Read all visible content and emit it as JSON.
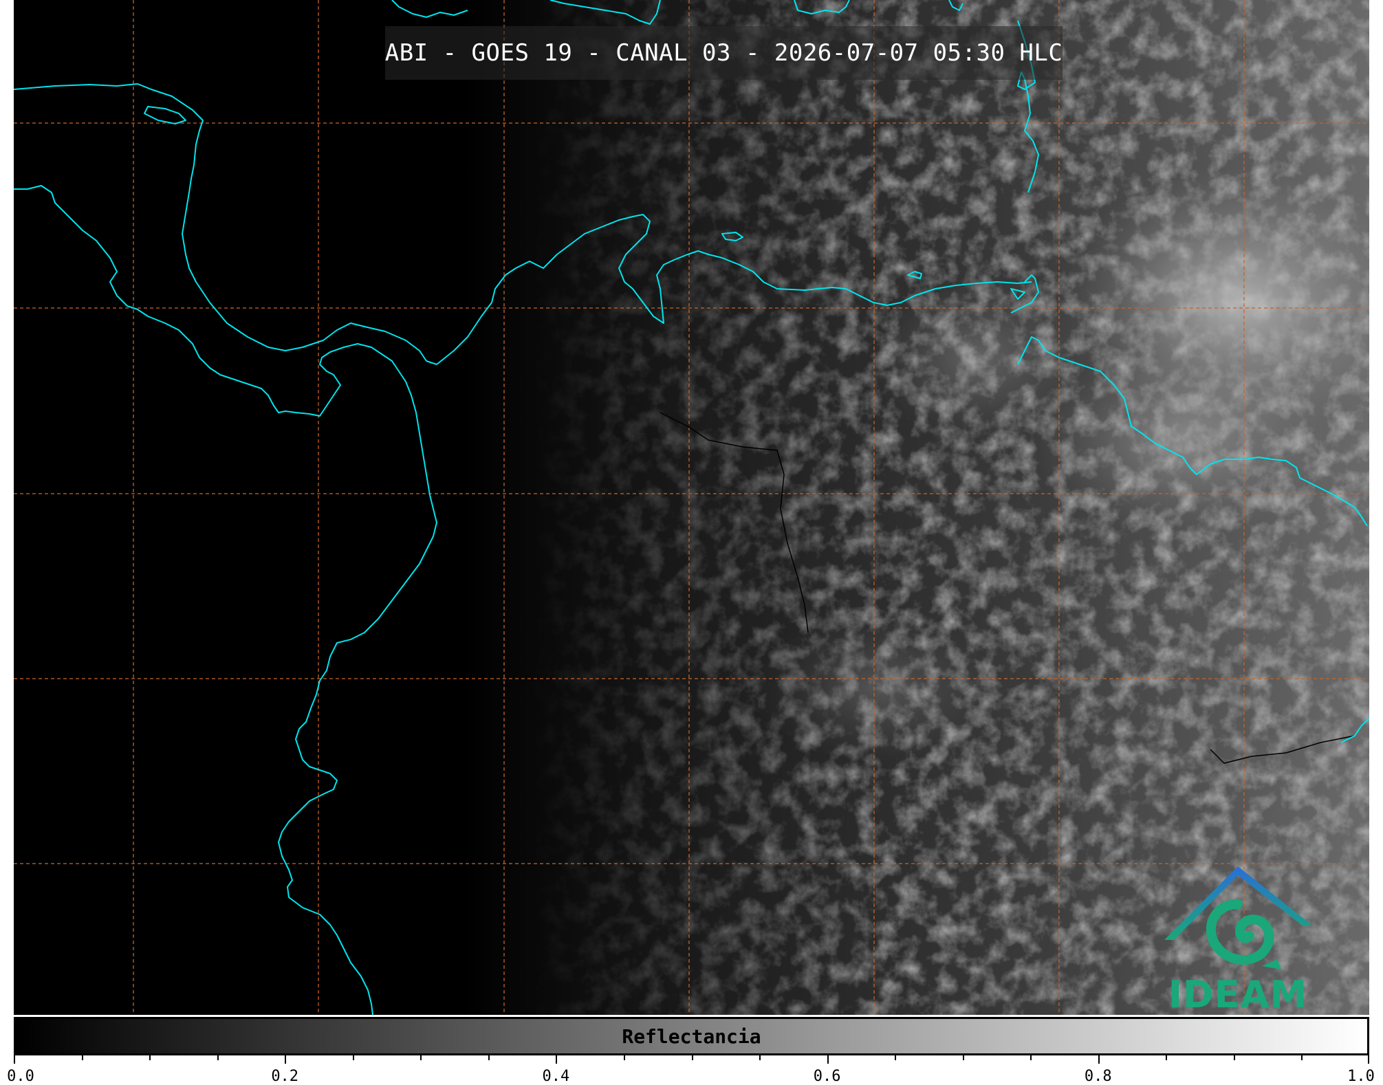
{
  "title": "ABI - GOES 19 - CANAL 03 - 2026-07-07 05:30 HLC",
  "logo": {
    "text": "IDEAM",
    "icon": "ideam-logo-icon"
  },
  "colorbar": {
    "label": "Reflectancia",
    "min": 0.0,
    "max": 1.0,
    "ticks": [
      "0.0",
      "0.2",
      "0.4",
      "0.6",
      "0.8",
      "1.0"
    ],
    "gradient": [
      "#000000",
      "#ffffff"
    ]
  },
  "colors": {
    "coastline": "#00e5ee",
    "graticule": "#c8642a",
    "borders": "#000000"
  }
}
